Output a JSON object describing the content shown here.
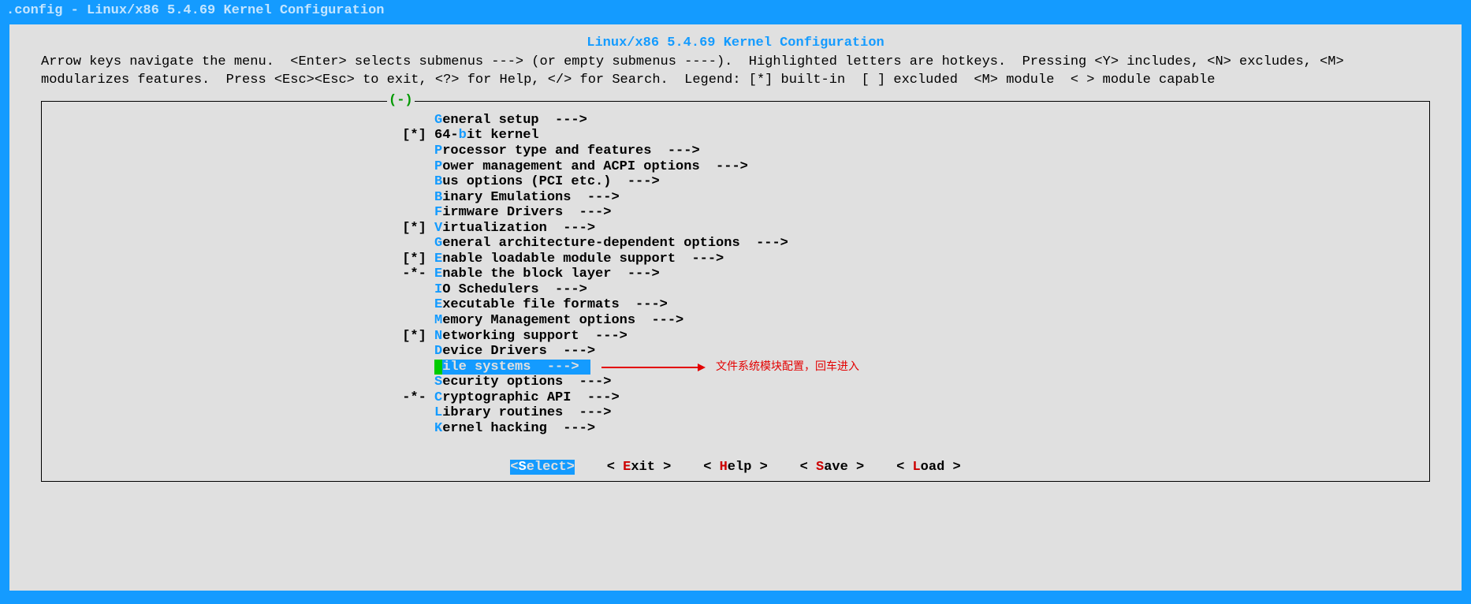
{
  "titlebar": ".config - Linux/x86 5.4.69 Kernel Configuration",
  "dialog_title": "Linux/x86 5.4.69 Kernel Configuration",
  "help_line1": "Arrow keys navigate the menu.  <Enter> selects submenus ---> (or empty submenus ----).  Highlighted letters are hotkeys.  Pressing <Y> includes, <N> excludes, <M>",
  "help_line2": "modularizes features.  Press <Esc><Esc> to exit, <?> for Help, </> for Search.  Legend: [*] built-in  [ ] excluded  <M> module  < > module capable",
  "frame_top": "(-)",
  "items": [
    {
      "prefix": "    ",
      "hk": "G",
      "rest": "eneral setup  --->"
    },
    {
      "prefix": "[*] ",
      "hk": "",
      "rest": "64-",
      "hk2": "b",
      "rest2": "it kernel"
    },
    {
      "prefix": "    ",
      "hk": "P",
      "rest": "rocessor type and features  --->"
    },
    {
      "prefix": "    ",
      "hk": "P",
      "rest": "ower management and ACPI options  --->"
    },
    {
      "prefix": "    ",
      "hk": "B",
      "rest": "us options (PCI etc.)  --->"
    },
    {
      "prefix": "    ",
      "hk": "B",
      "rest": "inary Emulations  --->"
    },
    {
      "prefix": "    ",
      "hk": "F",
      "rest": "irmware Drivers  --->"
    },
    {
      "prefix": "[*] ",
      "hk": "V",
      "rest": "irtualization  --->"
    },
    {
      "prefix": "    ",
      "hk": "G",
      "rest": "eneral architecture-dependent options  --->"
    },
    {
      "prefix": "[*] ",
      "hk": "E",
      "rest": "nable loadable module support  --->"
    },
    {
      "prefix": "-*- ",
      "hk": "E",
      "rest": "nable the block layer  --->"
    },
    {
      "prefix": "    ",
      "hk": "I",
      "rest": "O Schedulers  --->"
    },
    {
      "prefix": "    ",
      "hk": "E",
      "rest": "xecutable file formats  --->"
    },
    {
      "prefix": "    ",
      "hk": "M",
      "rest": "emory Management options  --->"
    },
    {
      "prefix": "[*] ",
      "hk": "N",
      "rest": "etworking support  --->"
    },
    {
      "prefix": "    ",
      "hk": "D",
      "rest": "evice Drivers  --->"
    },
    {
      "prefix": "    ",
      "hk": "F",
      "rest": "ile systems  ---> ",
      "selected": true
    },
    {
      "prefix": "    ",
      "hk": "S",
      "rest": "ecurity options  --->"
    },
    {
      "prefix": "-*- ",
      "hk": "C",
      "rest": "ryptographic API  --->"
    },
    {
      "prefix": "    ",
      "hk": "L",
      "rest": "ibrary routines  --->"
    },
    {
      "prefix": "    ",
      "hk": "K",
      "rest": "ernel hacking  --->"
    }
  ],
  "annotation": "文件系统模块配置，回车进入",
  "buttons": {
    "select_open": "<",
    "select_hk": "S",
    "select_rest": "elect>",
    "exit_open": "< ",
    "exit_hk": "E",
    "exit_rest": "xit >",
    "help_open": "< ",
    "help_hk": "H",
    "help_rest": "elp >",
    "save_open": "< ",
    "save_hk": "S",
    "save_rest": "ave >",
    "load_open": "< ",
    "load_hk": "L",
    "load_rest": "oad >"
  }
}
